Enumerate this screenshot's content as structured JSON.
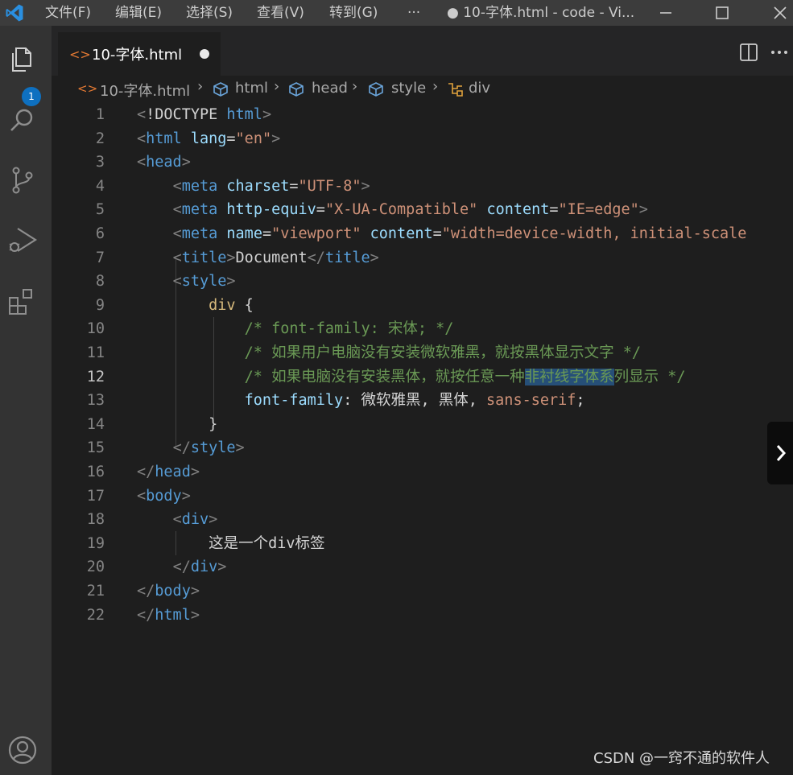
{
  "menu": [
    "文件(F)",
    "编辑(E)",
    "选择(S)",
    "查看(V)",
    "转到(G)",
    "···"
  ],
  "window_title": "● 10-字体.html - code - Vi...",
  "activity_badge": "1",
  "tab": {
    "label": "10-字体.html",
    "icon": "html-file-icon",
    "modified": true
  },
  "breadcrumb": [
    "10-字体.html",
    "html",
    "head",
    "style",
    "div"
  ],
  "code_lines": [
    {
      "n": "1",
      "tokens": [
        [
          "t",
          "<"
        ],
        [
          "tx",
          "!DOCTYPE "
        ],
        [
          "tg",
          "html"
        ],
        [
          "t",
          ">"
        ]
      ]
    },
    {
      "n": "2",
      "tokens": [
        [
          "t",
          "<"
        ],
        [
          "tg",
          "html"
        ],
        [
          "tx",
          " "
        ],
        [
          "at",
          "lang"
        ],
        [
          "tx",
          "="
        ],
        [
          "st",
          "\"en\""
        ],
        [
          "t",
          ">"
        ]
      ]
    },
    {
      "n": "3",
      "tokens": [
        [
          "t",
          "<"
        ],
        [
          "tg",
          "head"
        ],
        [
          "t",
          ">"
        ]
      ]
    },
    {
      "n": "4",
      "tokens": [
        [
          "tx",
          "    "
        ],
        [
          "t",
          "<"
        ],
        [
          "tg",
          "meta"
        ],
        [
          "tx",
          " "
        ],
        [
          "at",
          "charset"
        ],
        [
          "tx",
          "="
        ],
        [
          "st",
          "\"UTF-8\""
        ],
        [
          "t",
          ">"
        ]
      ]
    },
    {
      "n": "5",
      "tokens": [
        [
          "tx",
          "    "
        ],
        [
          "t",
          "<"
        ],
        [
          "tg",
          "meta"
        ],
        [
          "tx",
          " "
        ],
        [
          "at",
          "http-equiv"
        ],
        [
          "tx",
          "="
        ],
        [
          "st",
          "\"X-UA-Compatible\""
        ],
        [
          "tx",
          " "
        ],
        [
          "at",
          "content"
        ],
        [
          "tx",
          "="
        ],
        [
          "st",
          "\"IE=edge\""
        ],
        [
          "t",
          ">"
        ]
      ]
    },
    {
      "n": "6",
      "tokens": [
        [
          "tx",
          "    "
        ],
        [
          "t",
          "<"
        ],
        [
          "tg",
          "meta"
        ],
        [
          "tx",
          " "
        ],
        [
          "at",
          "name"
        ],
        [
          "tx",
          "="
        ],
        [
          "st",
          "\"viewport\""
        ],
        [
          "tx",
          " "
        ],
        [
          "at",
          "content"
        ],
        [
          "tx",
          "="
        ],
        [
          "st",
          "\"width=device-width, initial-scale"
        ]
      ]
    },
    {
      "n": "7",
      "tokens": [
        [
          "tx",
          "    "
        ],
        [
          "t",
          "<"
        ],
        [
          "tg",
          "title"
        ],
        [
          "t",
          ">"
        ],
        [
          "tx",
          "Document"
        ],
        [
          "t",
          "</"
        ],
        [
          "tg",
          "title"
        ],
        [
          "t",
          ">"
        ]
      ]
    },
    {
      "n": "8",
      "tokens": [
        [
          "tx",
          "    "
        ],
        [
          "t",
          "<"
        ],
        [
          "tg",
          "style"
        ],
        [
          "t",
          ">"
        ]
      ]
    },
    {
      "n": "9",
      "tokens": [
        [
          "tx",
          "        "
        ],
        [
          "sel",
          "div"
        ],
        [
          "tx",
          " {"
        ]
      ]
    },
    {
      "n": "10",
      "tokens": [
        [
          "tx",
          "            "
        ],
        [
          "cm",
          "/* font-family: 宋体; */"
        ]
      ]
    },
    {
      "n": "11",
      "tokens": [
        [
          "tx",
          "            "
        ],
        [
          "cm",
          "/* 如果用户电脑没有安装微软雅黑，就按黑体显示文字 */"
        ]
      ]
    },
    {
      "n": "12",
      "tokens": [
        [
          "tx",
          "            "
        ],
        [
          "cm",
          "/* 如果电脑没有安装黑体，就按任意一种"
        ],
        [
          "cm hl",
          "非衬线字体系"
        ],
        [
          "cm",
          "列显示 */"
        ]
      ]
    },
    {
      "n": "13",
      "tokens": [
        [
          "tx",
          "            "
        ],
        [
          "pr",
          "font-family"
        ],
        [
          "tx",
          ": 微软雅黑, 黑体, "
        ],
        [
          "st",
          "sans-serif"
        ],
        [
          "tx",
          ";"
        ]
      ]
    },
    {
      "n": "14",
      "tokens": [
        [
          "tx",
          "        }"
        ]
      ]
    },
    {
      "n": "15",
      "tokens": [
        [
          "tx",
          "    "
        ],
        [
          "t",
          "</"
        ],
        [
          "tg",
          "style"
        ],
        [
          "t",
          ">"
        ]
      ]
    },
    {
      "n": "16",
      "tokens": [
        [
          "t",
          "</"
        ],
        [
          "tg",
          "head"
        ],
        [
          "t",
          ">"
        ]
      ]
    },
    {
      "n": "17",
      "tokens": [
        [
          "t",
          "<"
        ],
        [
          "tg",
          "body"
        ],
        [
          "t",
          ">"
        ]
      ]
    },
    {
      "n": "18",
      "tokens": [
        [
          "tx",
          "    "
        ],
        [
          "t",
          "<"
        ],
        [
          "tg",
          "div"
        ],
        [
          "t",
          ">"
        ]
      ]
    },
    {
      "n": "19",
      "tokens": [
        [
          "tx",
          "        这是一个div标签"
        ]
      ]
    },
    {
      "n": "20",
      "tokens": [
        [
          "tx",
          "    "
        ],
        [
          "t",
          "</"
        ],
        [
          "tg",
          "div"
        ],
        [
          "t",
          ">"
        ]
      ]
    },
    {
      "n": "21",
      "tokens": [
        [
          "t",
          "</"
        ],
        [
          "tg",
          "body"
        ],
        [
          "t",
          ">"
        ]
      ]
    },
    {
      "n": "22",
      "tokens": [
        [
          "t",
          "</"
        ],
        [
          "tg",
          "html"
        ],
        [
          "t",
          ">"
        ]
      ]
    }
  ],
  "active_line": "12",
  "watermark": "CSDN @一窍不通的软件人",
  "colors": {
    "accent": "#0e70c0",
    "titlebar": "#3c3c3c",
    "activitybar": "#333333",
    "editor": "#1e1e1e",
    "selection": "#264f78"
  }
}
